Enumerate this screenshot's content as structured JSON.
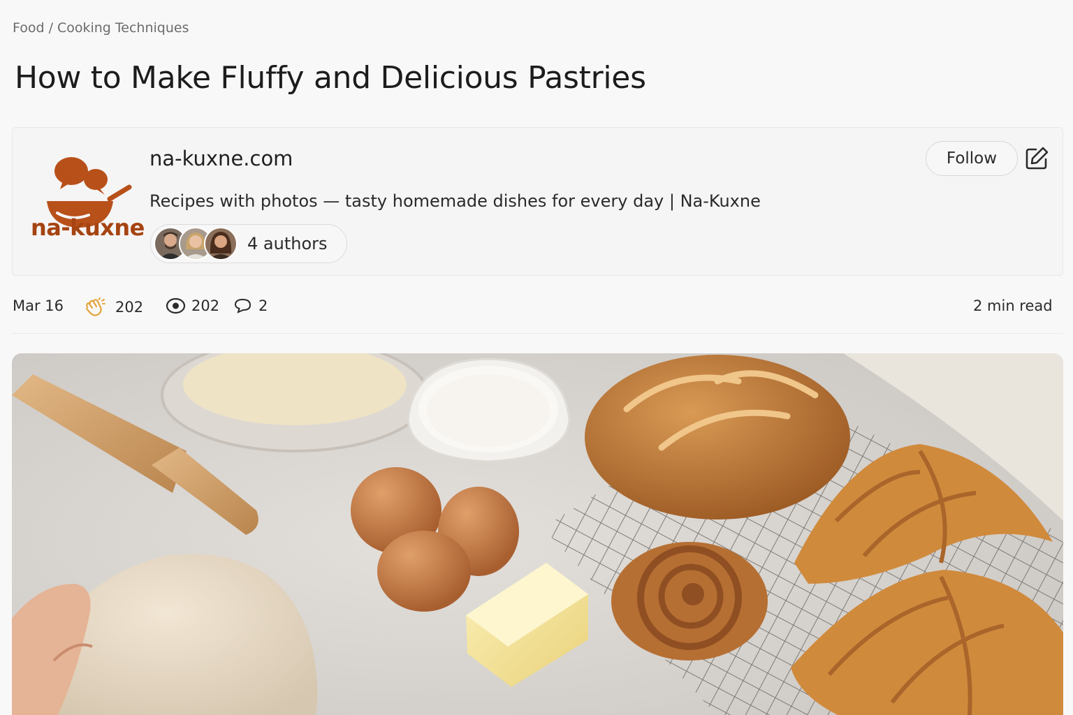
{
  "breadcrumb": {
    "section": "Food",
    "separator": "/",
    "category": "Cooking Techniques"
  },
  "article": {
    "title": "How to Make Fluffy and Delicious Pastries"
  },
  "publisher": {
    "logo_text": "na-kuxne",
    "site_name": "na-kuxne.com",
    "description": "Recipes with photos — tasty homemade dishes for every  day | Na-Kuxne",
    "authors_label": "4 authors",
    "follow_label": "Follow",
    "brand_color": "#a54412"
  },
  "meta": {
    "date": "Mar 16",
    "claps": "202",
    "views": "202",
    "comments": "2",
    "read_time": "2 min read"
  },
  "hero_image": {
    "subject": "baking-ingredients-and-pastries"
  }
}
